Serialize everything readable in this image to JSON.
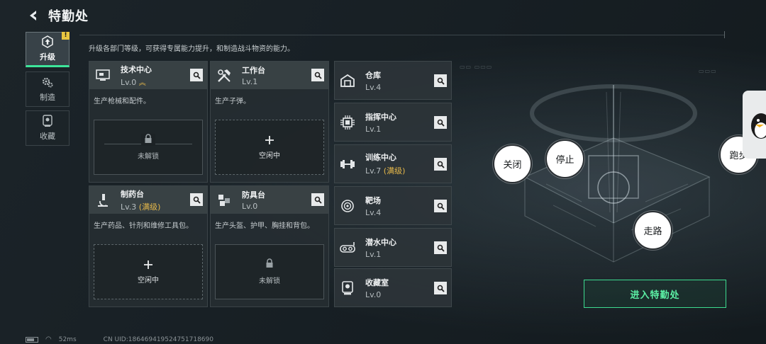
{
  "header": {
    "title": "特勤处"
  },
  "tabs": [
    {
      "label": "升级",
      "icon": "upgrade-icon",
      "active": true,
      "badge": "!"
    },
    {
      "label": "制造",
      "icon": "gears-icon",
      "active": false
    },
    {
      "label": "收藏",
      "icon": "collection-icon",
      "active": false
    }
  ],
  "description": "升级各部门等级，可获得专属能力提升，和制造战斗物资的能力。",
  "cards": [
    {
      "name": "技术中心",
      "level": "Lv.0",
      "desc": "生产枪械和配件。",
      "slot": "未解锁",
      "icon": "monitor-icon"
    },
    {
      "name": "工作台",
      "level": "Lv.1",
      "desc": "生产子弹。",
      "slot": "空闲中",
      "icon": "tools-icon"
    },
    {
      "name": "制药台",
      "level": "Lv.3",
      "max": "(满级)",
      "desc": "生产药品、针剂和维修工具包。",
      "slot": "空闲中",
      "icon": "microscope-icon"
    },
    {
      "name": "防具台",
      "level": "Lv.0",
      "desc": "生产头盔、护甲、胸挂和背包。",
      "slot": "未解锁",
      "icon": "armor-icon"
    }
  ],
  "list": [
    {
      "name": "仓库",
      "level": "Lv.4",
      "icon": "warehouse-icon"
    },
    {
      "name": "指挥中心",
      "level": "Lv.1",
      "icon": "chip-icon"
    },
    {
      "name": "训练中心",
      "level": "Lv.7",
      "max": "(满级)",
      "icon": "dumbbell-icon"
    },
    {
      "name": "靶场",
      "level": "Lv.4",
      "icon": "target-icon"
    },
    {
      "name": "潜水中心",
      "level": "Lv.1",
      "icon": "diving-mask-icon"
    },
    {
      "name": "收藏室",
      "level": "Lv.0",
      "icon": "trophy-icon"
    }
  ],
  "controls": {
    "close": "关闭",
    "stop": "停止",
    "run": "跑步",
    "walk": "走路"
  },
  "enter_button": "进入特勤处",
  "status": {
    "ping": "52ms",
    "uid": "CN UID:18646941952475171869​0"
  },
  "colors": {
    "accent_green": "#3de59a",
    "max_gold": "#e6b84a",
    "badge_yellow": "#e8c640"
  }
}
